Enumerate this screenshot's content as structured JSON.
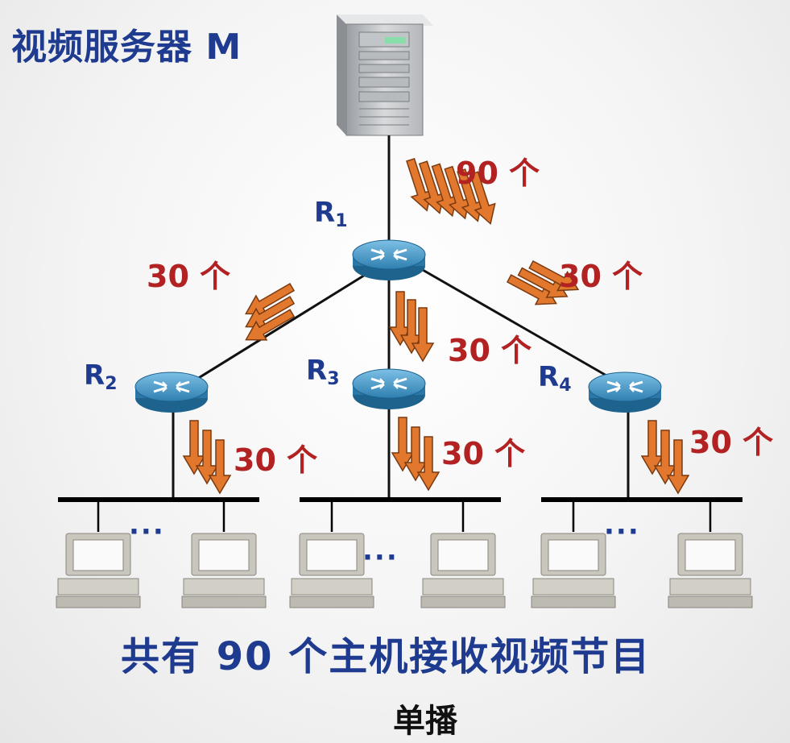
{
  "title": "视频服务器 M",
  "routers": [
    {
      "name": "R",
      "sub": "1"
    },
    {
      "name": "R",
      "sub": "2"
    },
    {
      "name": "R",
      "sub": "3"
    },
    {
      "name": "R",
      "sub": "4"
    }
  ],
  "flows": {
    "server_to_r1": "90 个",
    "r1_to_r2": "30 个",
    "r1_to_r3": "30 个",
    "r1_to_r4": "30 个",
    "r2_to_lan": "30 个",
    "r3_to_lan": "30 个",
    "r4_to_lan": "30 个"
  },
  "ellipsis": "···",
  "caption": "共有 90 个主机接收视频节目",
  "subtitle": "单播",
  "colors": {
    "text_blue": "#1f3b8f",
    "count_red": "#b22222",
    "arrow": "#e2782e",
    "router": "#3e8fc0"
  }
}
